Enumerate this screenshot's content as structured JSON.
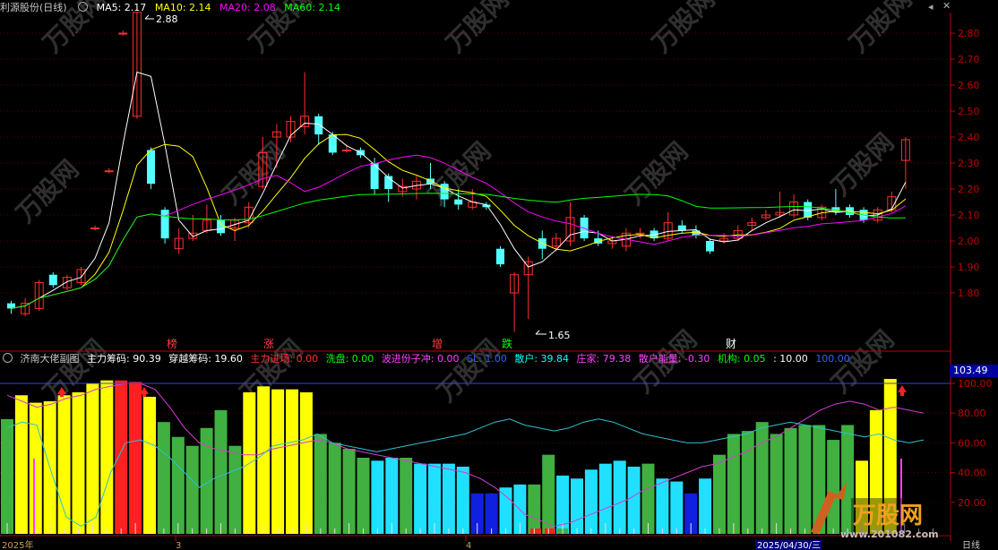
{
  "main": {
    "title": "利源股份(日线)",
    "ma": [
      {
        "label": "MA5: 2.17",
        "color": "#ffffff"
      },
      {
        "label": "MA10: 2.14",
        "color": "#ffff00"
      },
      {
        "label": "MA20: 2.08",
        "color": "#ff00ff"
      },
      {
        "label": "MA60: 2.14",
        "color": "#00ff00"
      }
    ],
    "price_ticks": [
      "2.80",
      "2.70",
      "2.60",
      "2.50",
      "2.40",
      "2.30",
      "2.20",
      "2.10",
      "2.00",
      "1.90",
      "1.80"
    ],
    "high_label": "2.88",
    "low_label": "1.65",
    "markers": [
      {
        "text": "榜",
        "color": "#ff4040"
      },
      {
        "text": "涨",
        "color": "#ff4040"
      },
      {
        "text": "增",
        "color": "#ff4040"
      },
      {
        "text": "跌",
        "color": "#00ff00"
      },
      {
        "text": "财",
        "color": "#ffffff"
      }
    ]
  },
  "indicator": {
    "title": "济南大佬副图",
    "fields": [
      {
        "label": "主力筹码: 90.39",
        "color": "#ffffff"
      },
      {
        "label": "穿越筹码: 19.60",
        "color": "#ffffff"
      },
      {
        "label": "主力进场: 0.00",
        "color": "#ff3030"
      },
      {
        "label": "洗盘: 0.00",
        "color": "#00ff00"
      },
      {
        "label": "波进份子冲: 0.00",
        "color": "#ff40ff"
      },
      {
        "label": "SL: 1.00",
        "color": "#3060ff"
      },
      {
        "label": "散户: 39.84",
        "color": "#00ffff"
      },
      {
        "label": "庄家: 79.38",
        "color": "#ff40ff"
      },
      {
        "label": "散户能量: -0.30",
        "color": "#ff40ff"
      },
      {
        "label": "机构: 0.05",
        "color": "#00ff00"
      },
      {
        "label": ": 10.00",
        "color": "#ffffff"
      },
      {
        "label": "100.00",
        "color": "#3060ff"
      }
    ],
    "ticks": [
      "100.00",
      "80.00",
      "60.00",
      "40.00",
      "20.00"
    ],
    "current_value": "103.49"
  },
  "bottom_axis": {
    "labels": [
      "2025年",
      "3",
      "4",
      "2025/04/30/三",
      "日线"
    ]
  },
  "watermark": {
    "brand": "万股网",
    "url": "www.201082.com"
  },
  "colors": {
    "up": "#ff3030",
    "down": "#54ffff",
    "grid": "#8b0000",
    "axis": "#c00000"
  }
}
